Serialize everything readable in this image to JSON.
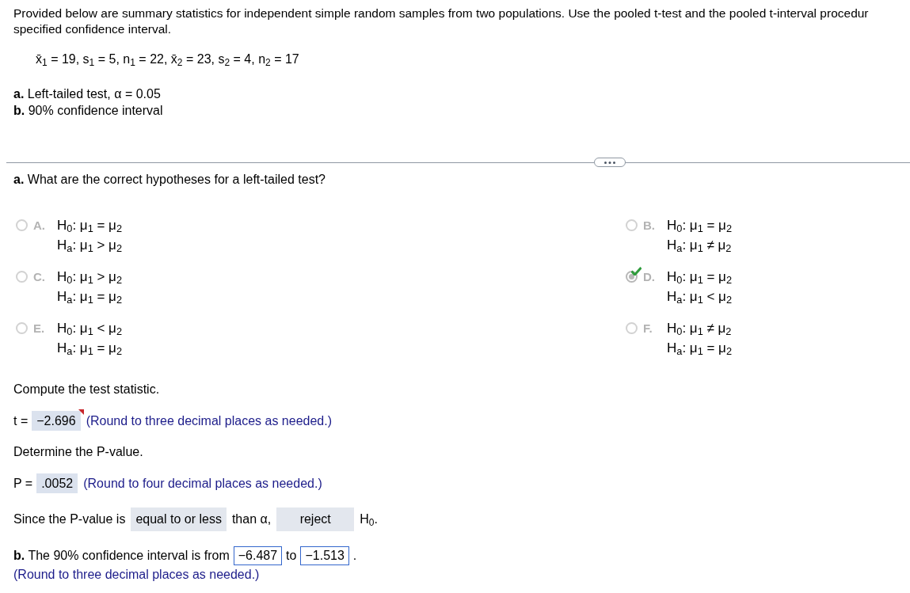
{
  "intro": {
    "lines": [
      "Provided below are summary statistics for independent simple random samples from two populations. Use the pooled t-test and the pooled t-interval procedur",
      "specified confidence interval."
    ]
  },
  "given": "x̄$_{1}$ = 19, s$_{1}$ = 5, n$_{1}$ = 22, x̄$_{2}$ = 23, s$_{2}$ = 4, n$_{2}$ = 17",
  "tasks": [
    "**a.** Left-tailed test, α = 0.05",
    "**b.** 90% confidence interval"
  ],
  "part_a": {
    "question": "**a.** What are the correct hypotheses for a left-tailed test?",
    "options": [
      {
        "letter": "A.",
        "h0": "H$_{0}$: μ$_{1}$ = μ$_{2}$",
        "ha": "H$_{a}$: μ$_{1}$ > μ$_{2}$",
        "selected": false
      },
      {
        "letter": "B.",
        "h0": "H$_{0}$: μ$_{1}$ = μ$_{2}$",
        "ha": "H$_{a}$: μ$_{1}$ ≠ μ$_{2}$",
        "selected": false
      },
      {
        "letter": "C.",
        "h0": "H$_{0}$: μ$_{1}$ > μ$_{2}$",
        "ha": "H$_{a}$: μ$_{1}$ = μ$_{2}$",
        "selected": false
      },
      {
        "letter": "D.",
        "h0": "H$_{0}$: μ$_{1}$ = μ$_{2}$",
        "ha": "H$_{a}$: μ$_{1}$ < μ$_{2}$",
        "selected": true
      },
      {
        "letter": "E.",
        "h0": "H$_{0}$: μ$_{1}$ < μ$_{2}$",
        "ha": "H$_{a}$: μ$_{1}$ = μ$_{2}$",
        "selected": false
      },
      {
        "letter": "F.",
        "h0": "H$_{0}$: μ$_{1}$ ≠ μ$_{2}$",
        "ha": "H$_{a}$: μ$_{1}$ = μ$_{2}$",
        "selected": false
      }
    ]
  },
  "test_statistic": {
    "prompt": "Compute the test statistic.",
    "label": "t =",
    "value": "−2.696",
    "flagged": true,
    "hint": "(Round to three decimal places as needed.)"
  },
  "p_value": {
    "prompt": "Determine the P-value.",
    "label": "P =",
    "value": ".0052",
    "flagged": false,
    "hint": "(Round to four decimal places as needed.)"
  },
  "conclusion": {
    "parts": [
      {
        "kind": "text",
        "text": "Since the P-value is"
      },
      {
        "kind": "dropdown",
        "value": "equal to or less"
      },
      {
        "kind": "text",
        "text": "than α,"
      },
      {
        "kind": "dropdown",
        "value": "reject"
      },
      {
        "kind": "text",
        "text": "H$_{0}$."
      }
    ]
  },
  "part_b": {
    "parts": [
      {
        "kind": "text",
        "text": "**b.** The 90% confidence interval is from"
      },
      {
        "kind": "field",
        "value": "−6.487"
      },
      {
        "kind": "text",
        "text": "to"
      },
      {
        "kind": "field",
        "value": "−1.513"
      },
      {
        "kind": "text",
        "text": "."
      }
    ],
    "hint": "(Round to three decimal places as needed.)"
  }
}
